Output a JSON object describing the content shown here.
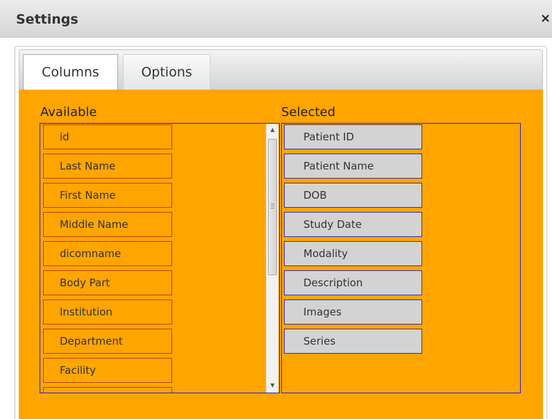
{
  "window": {
    "title": "Settings",
    "close_label": "×"
  },
  "tabs": [
    {
      "label": "Columns",
      "active": true
    },
    {
      "label": "Options",
      "active": false
    }
  ],
  "available": {
    "label": "Available",
    "items": [
      "id",
      "Last Name",
      "First Name",
      "Middle Name",
      "dicomname",
      "Body Part",
      "Institution",
      "Department",
      "Facility",
      ""
    ]
  },
  "selected": {
    "label": "Selected",
    "items": [
      "Patient ID",
      "Patient Name",
      "DOB",
      "Study Date",
      "Modality",
      "Description",
      "Images",
      "Series"
    ]
  },
  "scrollbar": {
    "up_arrow": "▲",
    "down_arrow": "▼"
  },
  "colors": {
    "panel_background": "#ffa500",
    "selected_item_background": "#d3d3d3",
    "list_border": "#2424c8"
  }
}
